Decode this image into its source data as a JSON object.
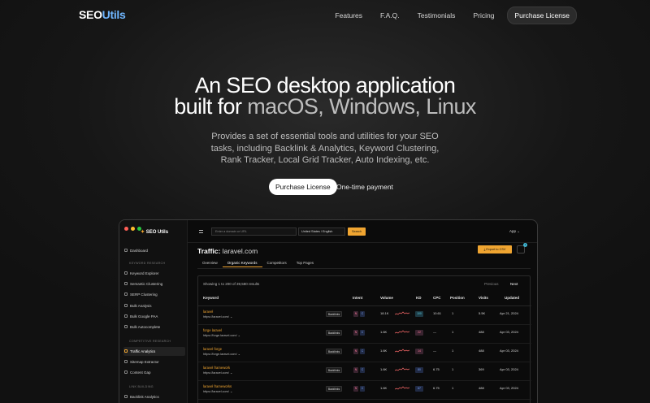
{
  "nav": {
    "logo_a": "SEO",
    "logo_b": "Utils",
    "links": [
      "Features",
      "F.A.Q.",
      "Testimonials",
      "Pricing"
    ],
    "purchase": "Purchase License"
  },
  "hero": {
    "line1": "An SEO desktop application",
    "line2_a": "built for ",
    "line2_b": "macOS, Windows, Linux",
    "subtitle": "Provides a set of essential tools and utilities for your SEO tasks, including Backlink & Analytics, Keyword Clustering, Rank Tracker, Local Grid Tracker, Auto Indexing, etc.",
    "cta": "Purchase License",
    "cta_note": "One-time payment"
  },
  "app": {
    "brand": "SEO Utils",
    "colors": {
      "accent": "#f0a531",
      "dot_red": "#ff5f57",
      "dot_yellow": "#febc2e",
      "dot_green": "#28c840"
    },
    "sidebar": {
      "dashboard": "Dashboard",
      "section_keyword": "KEYWORD RESEARCH",
      "keyword_items": [
        "Keyword Explorer",
        "Semantic Clustering",
        "SERP Clustering",
        "Bulk Analysis",
        "Bulk Google PAA",
        "Bulk Autocomplete"
      ],
      "section_competitive": "COMPETITIVE RESEARCH",
      "competitive_items": [
        "Traffic Analytics",
        "Sitemap Extractor",
        "Content Gap"
      ],
      "section_link": "LINK BUILDING",
      "link_items": [
        "Backlink Analytics"
      ]
    },
    "topbar": {
      "search_placeholder": "Enter a domain or URL",
      "region": "United States / English",
      "search_button": "Search",
      "app_menu": "App"
    },
    "main": {
      "title_bold": "Traffic:",
      "title_domain": "laravel.com",
      "export": "Export to CSV",
      "badge": "1",
      "tabs": [
        "Overview",
        "Organic Keywords",
        "Competitors",
        "Top Pages"
      ],
      "showing": "Showing 1 to 200 of 39,580 results",
      "prev": "Previous",
      "next": "Next",
      "columns": [
        "Keyword",
        "Intent",
        "Volume",
        "KD",
        "CPC",
        "Position",
        "Visits",
        "Updated"
      ],
      "rows": [
        {
          "keyword": "laravel",
          "url": "https://laravel.com/",
          "backlinks": "Backlinks",
          "intent_n": "N",
          "intent_c": "C",
          "volume": "18.1K",
          "kd": "100",
          "cpc": "10.61",
          "position": "1",
          "visits": "5.5K",
          "updated": "Apr 21, 2024"
        },
        {
          "keyword": "forge laravel",
          "url": "https://forge.laravel.com/",
          "backlinks": "Backlinks",
          "intent_n": "N",
          "intent_c": "C",
          "volume": "1.6K",
          "kd": "22",
          "cpc": "—",
          "position": "1",
          "visits": "488",
          "updated": "Apr 03, 2024"
        },
        {
          "keyword": "laravel forge",
          "url": "https://forge.laravel.com/",
          "backlinks": "Backlinks",
          "intent_n": "N",
          "intent_c": "C",
          "volume": "1.6K",
          "kd": "14",
          "cpc": "—",
          "position": "1",
          "visits": "488",
          "updated": "Apr 03, 2024"
        },
        {
          "keyword": "laravel framework",
          "url": "https://laravel.com/",
          "backlinks": "Backlinks",
          "intent_n": "N",
          "intent_c": "C",
          "volume": "1.6K",
          "kd": "80",
          "cpc": "6.75",
          "position": "1",
          "visits": "369",
          "updated": "Apr 03, 2024"
        },
        {
          "keyword": "laravel frameworks",
          "url": "https://laravel.com/",
          "backlinks": "Backlinks",
          "intent_n": "N",
          "intent_c": "C",
          "volume": "1.6K",
          "kd": "67",
          "cpc": "6.75",
          "position": "1",
          "visits": "488",
          "updated": "Apr 03, 2024"
        }
      ]
    }
  }
}
